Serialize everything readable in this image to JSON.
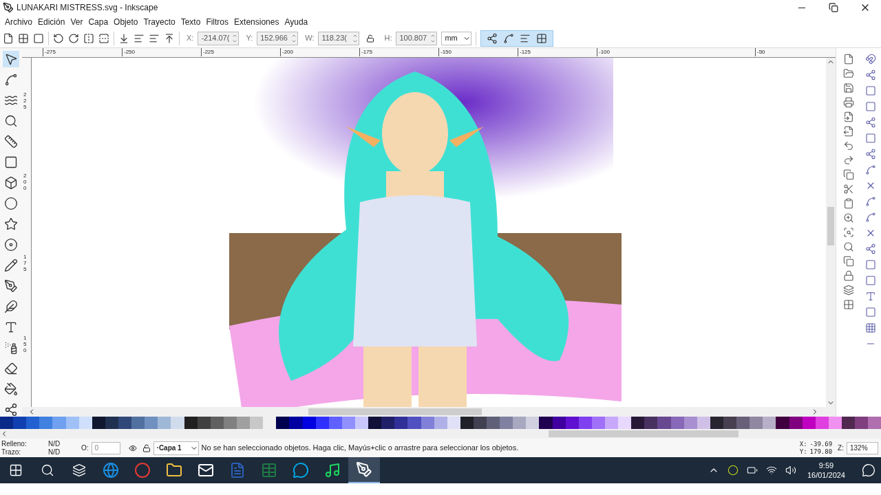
{
  "window": {
    "title": "LUNAKARI MISTRESS.svg - Inkscape"
  },
  "menu": [
    "Archivo",
    "Edición",
    "Ver",
    "Capa",
    "Objeto",
    "Trayecto",
    "Texto",
    "Filtros",
    "Extensiones",
    "Ayuda"
  ],
  "toolbar": {
    "fields": [
      {
        "label": "X:",
        "value": "-214.07("
      },
      {
        "label": "Y:",
        "value": "152.966"
      },
      {
        "label": "W:",
        "value": "118.23("
      },
      {
        "label": "H:",
        "value": "100.807"
      }
    ],
    "unit": "mm"
  },
  "ruler": {
    "horizontal": [
      "-275",
      "-250",
      "-225",
      "-200",
      "-175",
      "-150",
      "-125",
      "-100"
    ],
    "horizontal_end": "-50",
    "vertical": [
      "225",
      "200",
      "175",
      "150"
    ]
  },
  "swatches": [
    {
      "color": "#0a2a8a"
    },
    {
      "color": "#1040b0"
    },
    {
      "color": "#2060d0"
    },
    {
      "color": "#4080e0"
    },
    {
      "color": "#70a0f0"
    },
    {
      "color": "#a0c0f8"
    },
    {
      "color": "#d0e0fc"
    },
    {
      "color": "#101830"
    },
    {
      "color": "#203050"
    },
    {
      "color": "#304878"
    },
    {
      "color": "#5070a0"
    },
    {
      "color": "#7090c0"
    },
    {
      "color": "#a0b8d8"
    },
    {
      "color": "#d0dcec"
    },
    {
      "color": "#202020"
    },
    {
      "color": "#404040"
    },
    {
      "color": "#606060"
    },
    {
      "color": "#808080"
    },
    {
      "color": "#a0a0a0"
    },
    {
      "color": "#c8c8c8"
    },
    {
      "color": "#f0f0f0"
    },
    {
      "color": "#000050"
    },
    {
      "color": "#0000a0"
    },
    {
      "color": "#0000e0"
    },
    {
      "color": "#3030ff"
    },
    {
      "color": "#6060ff"
    },
    {
      "color": "#9090ff"
    },
    {
      "color": "#c8c8ff"
    },
    {
      "color": "#101038"
    },
    {
      "color": "#202068"
    },
    {
      "color": "#303098"
    },
    {
      "color": "#5050c0"
    },
    {
      "color": "#8080d8"
    },
    {
      "color": "#b0b0e8"
    },
    {
      "color": "#e0e0f8"
    },
    {
      "color": "#202028"
    },
    {
      "color": "#404050"
    },
    {
      "color": "#606078"
    },
    {
      "color": "#8080a0"
    },
    {
      "color": "#a8a8c0"
    },
    {
      "color": "#d0d0e0"
    },
    {
      "color": "#200050"
    },
    {
      "color": "#4000a0"
    },
    {
      "color": "#6010d0"
    },
    {
      "color": "#8040f0"
    },
    {
      "color": "#a070f8"
    },
    {
      "color": "#c8a8fc"
    },
    {
      "color": "#e8d8fe"
    },
    {
      "color": "#281838"
    },
    {
      "color": "#483060"
    },
    {
      "color": "#684890"
    },
    {
      "color": "#8868b8"
    },
    {
      "color": "#a890d0"
    },
    {
      "color": "#d0c0e8"
    },
    {
      "color": "#282430"
    },
    {
      "color": "#484050"
    },
    {
      "color": "#686078"
    },
    {
      "color": "#9088a0"
    },
    {
      "color": "#b8b0c8"
    },
    {
      "color": "#400040"
    },
    {
      "color": "#800080"
    },
    {
      "color": "#c000c0"
    },
    {
      "color": "#e040e0"
    },
    {
      "color": "#f090f0"
    },
    {
      "color": "#502850"
    },
    {
      "color": "#804080"
    },
    {
      "color": "#b070b0"
    }
  ],
  "status": {
    "fill_label": "Relleno:",
    "fill_value": "N/D",
    "stroke_label": "Trazo:",
    "stroke_value": "N/D",
    "opacity_label": "O:",
    "opacity_value": "0",
    "layer": "·Capa 1",
    "message": "No se han seleccionado objetos. Haga clic, Mayús+clic o arrastre para seleccionar los objetos.",
    "x_label": "X:",
    "x_value": "-39.69",
    "y_label": "Y:",
    "y_value": "179.80",
    "zoom_label": "Z:",
    "zoom_value": "132%"
  },
  "taskbar": {
    "apps": [
      {
        "kind": "edge",
        "selected": false
      },
      {
        "kind": "chrome",
        "selected": false
      },
      {
        "kind": "files",
        "selected": false
      },
      {
        "kind": "mail",
        "selected": false
      },
      {
        "kind": "word",
        "selected": false
      },
      {
        "kind": "excel",
        "selected": false
      },
      {
        "kind": "skype",
        "selected": false
      },
      {
        "kind": "spotify",
        "selected": false
      },
      {
        "kind": "inkscape",
        "selected": true
      }
    ],
    "time": "9:59",
    "date": "16/01/2024"
  }
}
